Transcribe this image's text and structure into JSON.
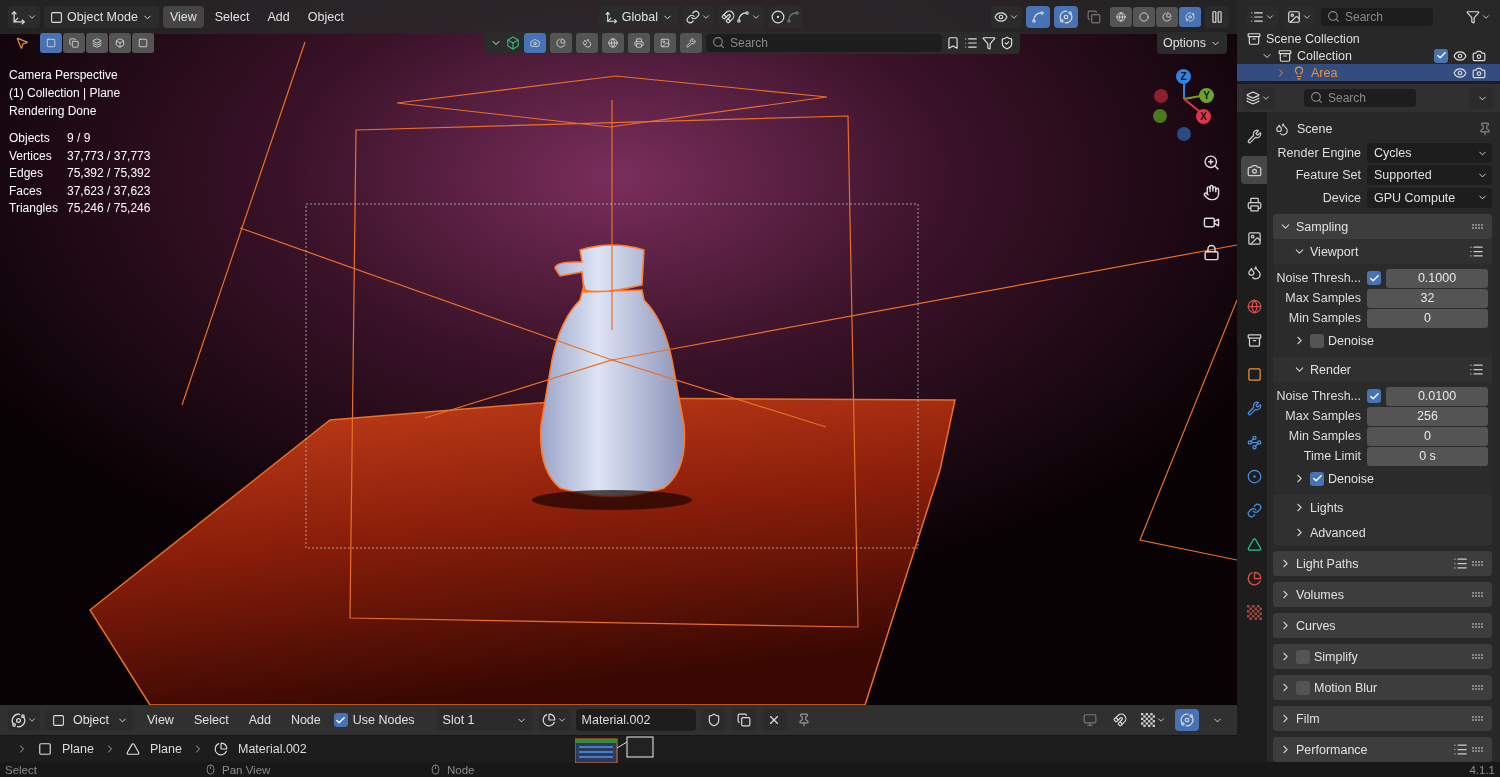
{
  "viewport_header": {
    "mode": "Object Mode",
    "menus": [
      {
        "label": "View",
        "selected": true
      },
      {
        "label": "Select",
        "selected": false
      },
      {
        "label": "Add",
        "selected": false
      },
      {
        "label": "Object",
        "selected": false
      }
    ],
    "orientation": "Global",
    "shading": [
      {
        "kind": "wireframe",
        "selected": false
      },
      {
        "kind": "solid",
        "selected": false
      },
      {
        "kind": "material",
        "selected": false
      },
      {
        "kind": "rendered",
        "selected": true
      }
    ]
  },
  "tool_header": {
    "select_modes": [
      {
        "kind": "new",
        "selected": true
      },
      {
        "kind": "extend",
        "selected": false
      },
      {
        "kind": "subtract",
        "selected": false
      },
      {
        "kind": "invert",
        "selected": false
      },
      {
        "kind": "intersect",
        "selected": false
      }
    ],
    "search": {
      "placeholder": "Search"
    },
    "options": "Options"
  },
  "overlay": {
    "lines": [
      "Camera Perspective",
      "(1) Collection | Plane",
      "Rendering Done"
    ],
    "stats": [
      {
        "label": "Objects",
        "value": "9 / 9"
      },
      {
        "label": "Vertices",
        "value": "37,773 / 37,773"
      },
      {
        "label": "Edges",
        "value": "75,392 / 75,392"
      },
      {
        "label": "Faces",
        "value": "37,623 / 37,623"
      },
      {
        "label": "Triangles",
        "value": "75,246 / 75,246"
      }
    ]
  },
  "gizmo": {
    "axes": [
      {
        "label": "X",
        "color": "#e0344e"
      },
      {
        "label": "Y",
        "color": "#6ea526"
      },
      {
        "label": "Z",
        "color": "#2f83e3"
      }
    ]
  },
  "outliner": {
    "search": {
      "placeholder": "Search"
    },
    "items": [
      {
        "label": "Scene Collection",
        "kind": "scene",
        "children": [
          {
            "label": "Collection",
            "kind": "collection",
            "expanded": true,
            "checked": true,
            "children": [
              {
                "label": "Area",
                "kind": "light",
                "expanded": false
              }
            ]
          }
        ]
      }
    ]
  },
  "properties": {
    "search": {
      "placeholder": "Search"
    },
    "tabs": [
      {
        "kind": "tool",
        "selected": false
      },
      {
        "kind": "render",
        "selected": true
      },
      {
        "kind": "output",
        "selected": false
      },
      {
        "kind": "view_layer",
        "selected": false
      },
      {
        "kind": "scene",
        "selected": false
      },
      {
        "kind": "world",
        "selected": false
      },
      {
        "kind": "collection",
        "selected": false
      },
      {
        "kind": "object",
        "selected": false
      },
      {
        "kind": "modifiers",
        "selected": false
      },
      {
        "kind": "particles",
        "selected": false
      },
      {
        "kind": "physics",
        "selected": false
      },
      {
        "kind": "constraints",
        "selected": false
      },
      {
        "kind": "data",
        "selected": false
      },
      {
        "kind": "material",
        "selected": false
      },
      {
        "kind": "texture",
        "selected": false
      }
    ],
    "context": "Scene",
    "fields": [
      {
        "label": "Render Engine",
        "value": "Cycles"
      },
      {
        "label": "Feature Set",
        "value": "Supported"
      },
      {
        "label": "Device",
        "value": "GPU Compute"
      }
    ],
    "sampling": {
      "title": "Sampling",
      "expanded": true,
      "sections": [
        {
          "title": "Viewport",
          "expanded": true,
          "presets": true,
          "rows": [
            {
              "kind": "check_value",
              "label": "Noise Thresh...",
              "checked": true,
              "value": "0.1000"
            },
            {
              "kind": "value",
              "label": "Max Samples",
              "value": "32"
            },
            {
              "kind": "value",
              "label": "Min Samples",
              "value": "0"
            }
          ],
          "subpanels": [
            {
              "title": "Denoise",
              "kind": "toggle",
              "checked": false,
              "expanded": false
            }
          ]
        },
        {
          "title": "Render",
          "expanded": true,
          "presets": true,
          "rows": [
            {
              "kind": "check_value",
              "label": "Noise Thresh...",
              "checked": true,
              "value": "0.0100"
            },
            {
              "kind": "value",
              "label": "Max Samples",
              "value": "256"
            },
            {
              "kind": "value",
              "label": "Min Samples",
              "value": "0"
            },
            {
              "kind": "value",
              "label": "Time Limit",
              "value": "0 s"
            }
          ],
          "subpanels": [
            {
              "title": "Denoise",
              "kind": "toggle",
              "checked": true,
              "expanded": false
            }
          ]
        },
        {
          "title": "Lights",
          "expanded": false,
          "presets": false
        },
        {
          "title": "Advanced",
          "expanded": false,
          "presets": false
        }
      ]
    },
    "panels": [
      {
        "title": "Light Paths",
        "kind": "plain",
        "expanded": false,
        "presets": true
      },
      {
        "title": "Volumes",
        "kind": "plain",
        "expanded": false,
        "presets": false
      },
      {
        "title": "Curves",
        "kind": "plain",
        "expanded": false,
        "presets": false
      },
      {
        "title": "Simplify",
        "kind": "toggle",
        "checked": false,
        "expanded": false,
        "presets": false
      },
      {
        "title": "Motion Blur",
        "kind": "toggle",
        "checked": false,
        "expanded": false,
        "presets": false
      },
      {
        "title": "Film",
        "kind": "plain",
        "expanded": false,
        "presets": false
      },
      {
        "title": "Performance",
        "kind": "plain",
        "expanded": false,
        "presets": true
      }
    ]
  },
  "node_header": {
    "mode": "Object",
    "menus": [
      "View",
      "Select",
      "Add",
      "Node"
    ],
    "use_nodes": {
      "label": "Use Nodes",
      "checked": true
    },
    "slot": "Slot 1",
    "material": "Material.002"
  },
  "breadcrumb": [
    {
      "label": "Plane",
      "kind": "object"
    },
    {
      "label": "Plane",
      "kind": "mesh"
    },
    {
      "label": "Material.002",
      "kind": "material"
    }
  ],
  "status_bar": {
    "items": [
      "Select",
      "Pan View",
      "Node"
    ],
    "version": "4.1.1"
  }
}
